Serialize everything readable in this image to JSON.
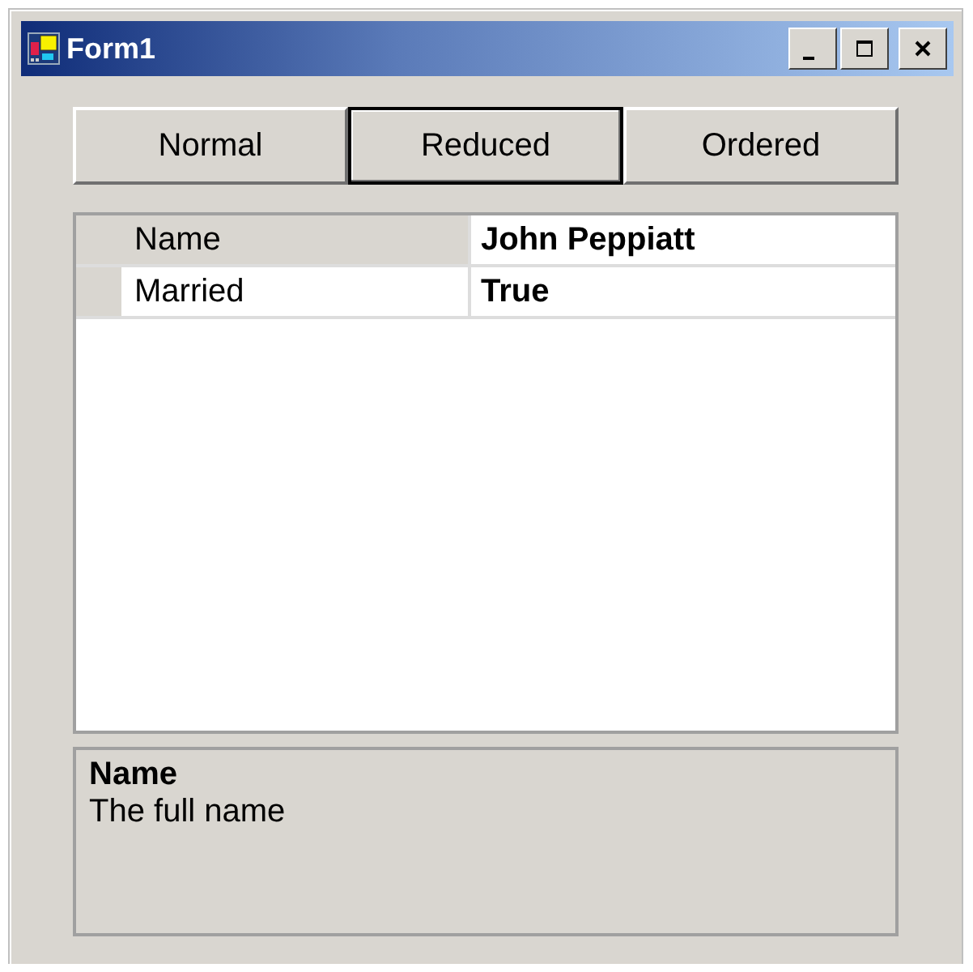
{
  "window": {
    "title": "Form1"
  },
  "buttons": [
    {
      "label": "Normal",
      "selected": false
    },
    {
      "label": "Reduced",
      "selected": true
    },
    {
      "label": "Ordered",
      "selected": false
    }
  ],
  "properties": [
    {
      "name": "Name",
      "value": "John Peppiatt",
      "selected": true
    },
    {
      "name": "Married",
      "value": "True",
      "selected": false
    }
  ],
  "description": {
    "title": "Name",
    "text": "The full name"
  }
}
